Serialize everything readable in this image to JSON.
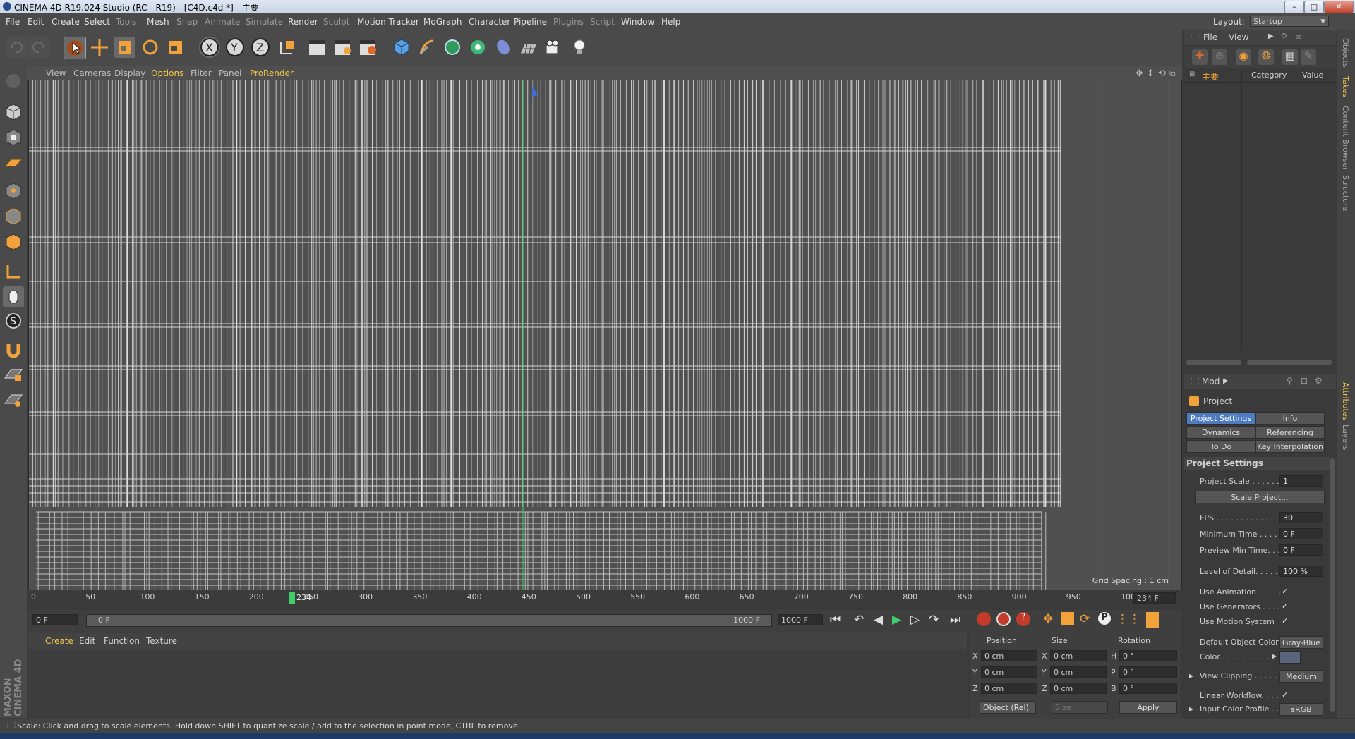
{
  "window": {
    "title": "CINEMA 4D R19.024 Studio (RC - R19) - [C4D.c4d *] - 主要",
    "min": "–",
    "max": "□",
    "close": "✕"
  },
  "menubar": {
    "items": [
      "File",
      "Edit",
      "Create",
      "Select",
      "Tools",
      "Mesh",
      "Snap",
      "Animate",
      "Simulate",
      "Render",
      "Sculpt",
      "Motion Tracker",
      "MoGraph",
      "Character",
      "Pipeline",
      "Plugins",
      "Script",
      "Window",
      "Help"
    ],
    "layout_label": "Layout:",
    "layout_value": "Startup"
  },
  "toolbar": {
    "axis_x": "X",
    "axis_y": "Y",
    "axis_z": "Z"
  },
  "viewport": {
    "menu": [
      "View",
      "Cameras",
      "Display",
      "Options",
      "Filter",
      "Panel",
      "ProRender"
    ],
    "grid_spacing": "Grid Spacing : 1 cm"
  },
  "timeline": {
    "ticks": [
      "0",
      "50",
      "100",
      "150",
      "200",
      "250",
      "300",
      "350",
      "400",
      "450",
      "500",
      "550",
      "600",
      "650",
      "700",
      "750",
      "800",
      "850",
      "900",
      "950",
      "100"
    ],
    "current_marker": "234",
    "current_frame": "234 F",
    "start_field": "0 F",
    "range_start": "0 F",
    "range_end": "1000 F",
    "end_field": "1000 F"
  },
  "materials": {
    "menu": [
      "Create",
      "Edit",
      "Function",
      "Texture"
    ]
  },
  "coordinates": {
    "headers": [
      "Position",
      "Size",
      "Rotation"
    ],
    "rows": [
      {
        "axis": "X",
        "pos": "0 cm",
        "size_axis": "X",
        "size": "0 cm",
        "rot_axis": "H",
        "rot": "0 °"
      },
      {
        "axis": "Y",
        "pos": "0 cm",
        "size_axis": "Y",
        "size": "0 cm",
        "rot_axis": "P",
        "rot": "0 °"
      },
      {
        "axis": "Z",
        "pos": "0 cm",
        "size_axis": "Z",
        "size": "0 cm",
        "rot_axis": "B",
        "rot": "0 °"
      }
    ],
    "mode": "Object (Rel)",
    "size_mode": "Size",
    "apply": "Apply"
  },
  "objects_panel": {
    "menu": [
      "File",
      "View"
    ],
    "take_name": "主要",
    "columns": [
      "Category",
      "Value"
    ]
  },
  "attributes": {
    "mode": "Mod",
    "header": "Project",
    "tabs": [
      "Project Settings",
      "Info",
      "Dynamics",
      "Referencing",
      "To Do",
      "Key Interpolation"
    ],
    "section": "Project Settings",
    "fields": [
      {
        "label": "Project Scale . . . . . .",
        "value": "1"
      },
      {
        "label": "FPS . . . . . . . . . . . . . .",
        "value": "30"
      },
      {
        "label": "Minimum Time . . . .",
        "value": "0 F"
      },
      {
        "label": "Preview Min Time. . .",
        "value": "0 F"
      },
      {
        "label": "Level of Detail. . . . .",
        "value": "100 %"
      }
    ],
    "scale_button": "Scale Project...",
    "checks": [
      {
        "label": "Use Animation . . . . .",
        "value": "✓"
      },
      {
        "label": "Use Generators . . . .",
        "value": "✓"
      },
      {
        "label": "Use Motion System",
        "value": "✓"
      }
    ],
    "default_color_label": "Default Object Color",
    "default_color_value": "Gray-Blue",
    "color_label": "Color . . . . . . . . . . .",
    "view_clipping_label": "View Clipping . . . . . .",
    "view_clipping_value": "Medium",
    "linear_workflow_label": "Linear Workflow. . . .",
    "linear_workflow_value": "✓",
    "input_profile_label": "Input Color Profile . .",
    "input_profile_value": "sRGB"
  },
  "side_tabs": [
    "Objects",
    "Takes",
    "Content Browser",
    "Structure",
    "Attributes",
    "Layers"
  ],
  "status": "Scale: Click and drag to scale elements. Hold down SHIFT to quantize scale / add to the selection in point mode, CTRL to remove.",
  "branding": "MAXON CINEMA 4D",
  "colors": {
    "accent": "#4d7bbf",
    "active_menu": "#f2c94c",
    "timeline_marker": "#3ecf6a"
  }
}
